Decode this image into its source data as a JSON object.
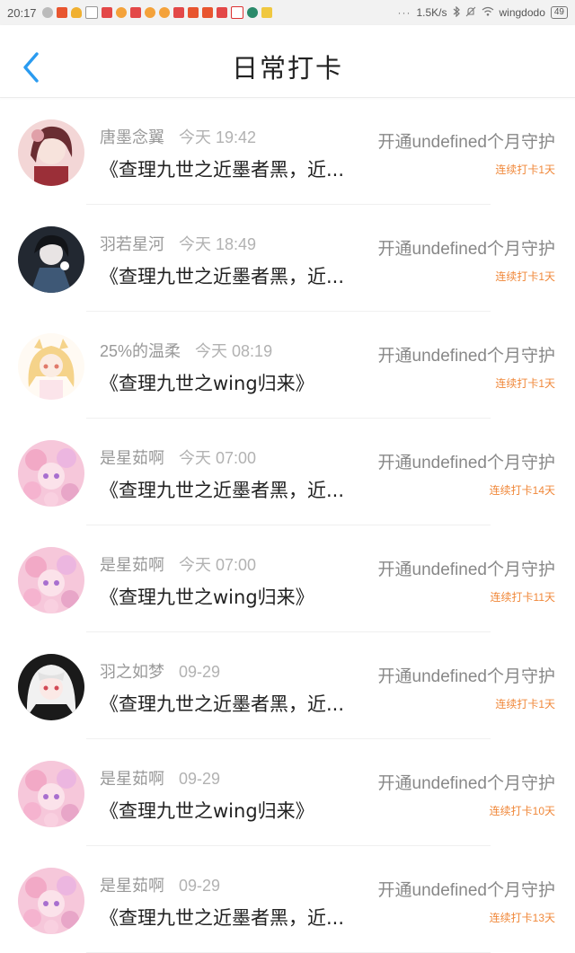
{
  "status_bar": {
    "time": "20:17",
    "network_speed": "1.5K/s",
    "wifi_name": "wingdodo",
    "battery": "49",
    "icons": [
      "wechat-icon",
      "app-icon",
      "cloud-icon",
      "app-icon",
      "app-icon",
      "app-icon",
      "app-icon",
      "app-icon",
      "app-icon",
      "app-icon",
      "app-icon",
      "app-icon",
      "app-icon",
      "app-icon",
      "app-icon",
      "app-icon"
    ]
  },
  "header": {
    "title": "日常打卡",
    "back_icon": "chevron-left-icon"
  },
  "colors": {
    "accent_blue": "#2a9bf0",
    "streak_orange": "#f0883a",
    "text_gray": "#999999"
  },
  "entries": [
    {
      "name": "唐墨念翼",
      "time": "今天 19:42",
      "book": "《查理九世之近墨者黑，近...",
      "action": "开通undefined个月守护",
      "streak": "连续打卡1天",
      "avatar": "avatar-dark-hair"
    },
    {
      "name": "羽若星河",
      "time": "今天 18:49",
      "book": "《查理九世之近墨者黑，近...",
      "action": "开通undefined个月守护",
      "streak": "连续打卡1天",
      "avatar": "avatar-black-white"
    },
    {
      "name": "25%的温柔",
      "time": "今天 08:19",
      "book": "《查理九世之wing归来》",
      "action": "开通undefined个月守护",
      "streak": "连续打卡1天",
      "avatar": "avatar-blonde"
    },
    {
      "name": "是星茹啊",
      "time": "今天 07:00",
      "book": "《查理九世之近墨者黑，近...",
      "action": "开通undefined个月守护",
      "streak": "连续打卡14天",
      "avatar": "avatar-pink"
    },
    {
      "name": "是星茹啊",
      "time": "今天 07:00",
      "book": "《查理九世之wing归来》",
      "action": "开通undefined个月守护",
      "streak": "连续打卡11天",
      "avatar": "avatar-pink"
    },
    {
      "name": "羽之如梦",
      "time": "09-29",
      "book": "《查理九世之近墨者黑，近...",
      "action": "开通undefined个月守护",
      "streak": "连续打卡1天",
      "avatar": "avatar-white-hair"
    },
    {
      "name": "是星茹啊",
      "time": "09-29",
      "book": "《查理九世之wing归来》",
      "action": "开通undefined个月守护",
      "streak": "连续打卡10天",
      "avatar": "avatar-pink"
    },
    {
      "name": "是星茹啊",
      "time": "09-29",
      "book": "《查理九世之近墨者黑，近...",
      "action": "开通undefined个月守护",
      "streak": "连续打卡13天",
      "avatar": "avatar-pink"
    }
  ]
}
